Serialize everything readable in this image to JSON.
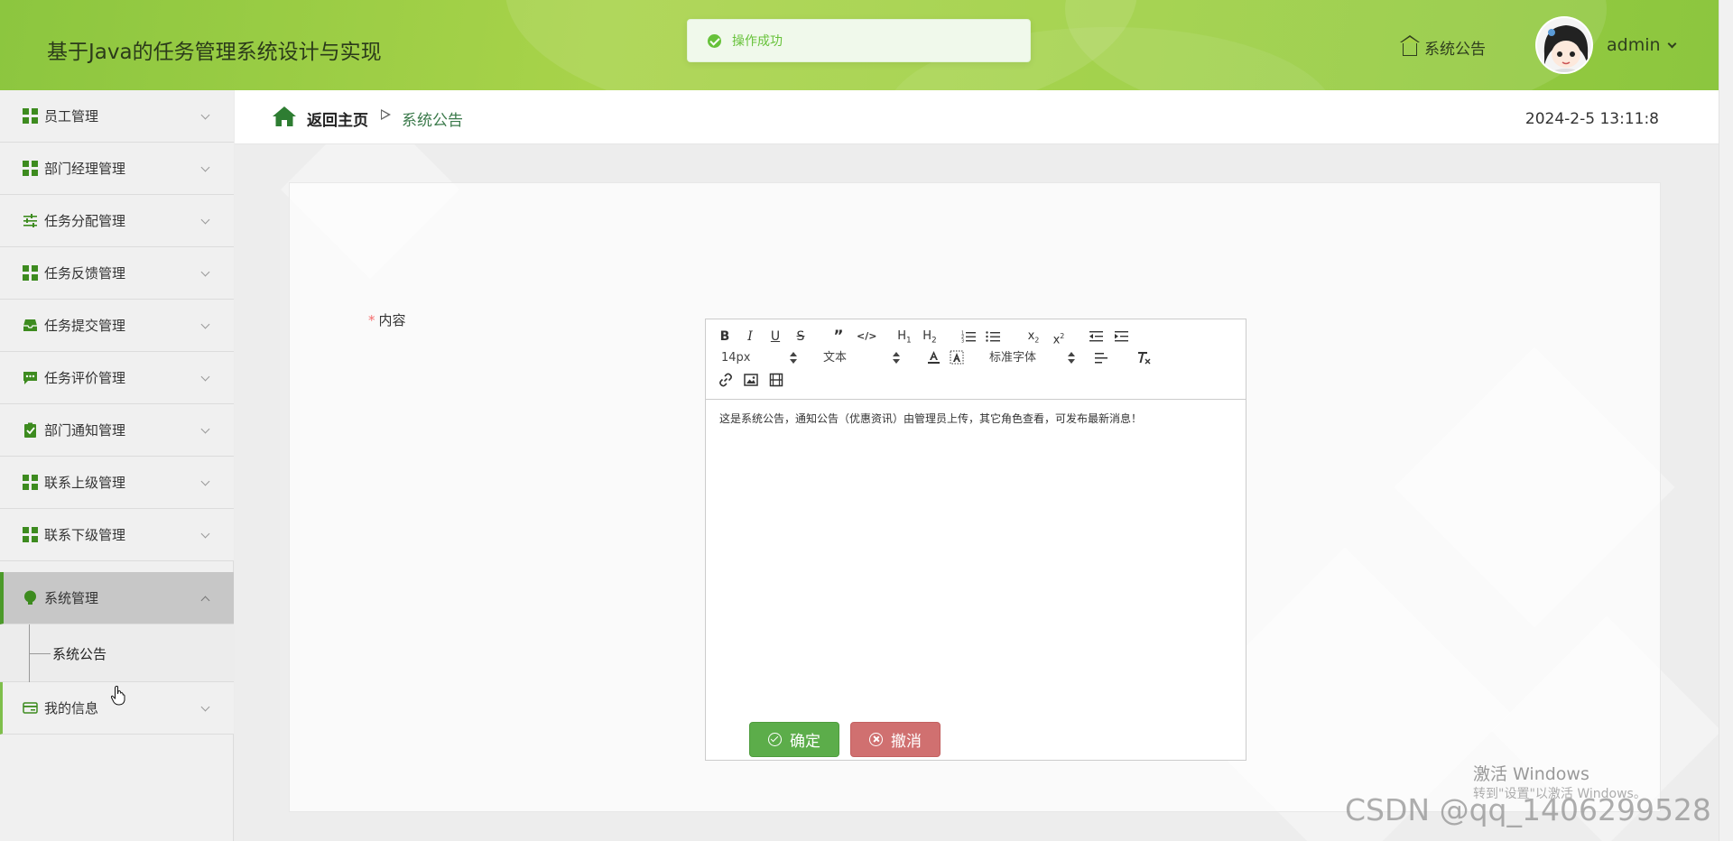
{
  "header": {
    "title": "基于Java的任务管理系统设计与实现",
    "notice_link": "系统公告",
    "username": "admin"
  },
  "toast": {
    "message": "操作成功"
  },
  "sidebar": {
    "items": [
      {
        "label": "员工管理",
        "icon": "grid-icon"
      },
      {
        "label": "部门经理管理",
        "icon": "grid-icon"
      },
      {
        "label": "任务分配管理",
        "icon": "sliders-icon"
      },
      {
        "label": "任务反馈管理",
        "icon": "grid-icon"
      },
      {
        "label": "任务提交管理",
        "icon": "inbox-icon"
      },
      {
        "label": "任务评价管理",
        "icon": "chat-icon"
      },
      {
        "label": "部门通知管理",
        "icon": "clipboard-check-icon"
      },
      {
        "label": "联系上级管理",
        "icon": "grid-icon"
      },
      {
        "label": "联系下级管理",
        "icon": "grid-icon"
      },
      {
        "label": "系统管理",
        "icon": "bulb-icon"
      },
      {
        "label": "我的信息",
        "icon": "card-icon"
      }
    ],
    "submenu": {
      "label": "系统公告"
    }
  },
  "breadcrumb": {
    "home": "返回主页",
    "current": "系统公告",
    "datetime": "2024-2-5 13:11:8"
  },
  "form": {
    "content_label": "内容",
    "required_mark": "*"
  },
  "editor": {
    "font_size": "14px",
    "block_format": "文本",
    "font_family": "标准字体",
    "content": "这是系统公告，通知公告（优惠资讯）由管理员上传，其它角色查看，可发布最新消息！"
  },
  "buttons": {
    "confirm": "确定",
    "cancel": "撤消"
  },
  "watermarks": {
    "win_title": "激活 Windows",
    "win_sub": "转到\"设置\"以激活 Windows。",
    "csdn": "CSDN @qq_1406299528"
  },
  "colors": {
    "header_green": "#8cc63f",
    "accent_green": "#3d8b1f",
    "confirm_green": "#5cad4a",
    "cancel_red": "#d07070",
    "toast_green": "#67c23a"
  }
}
